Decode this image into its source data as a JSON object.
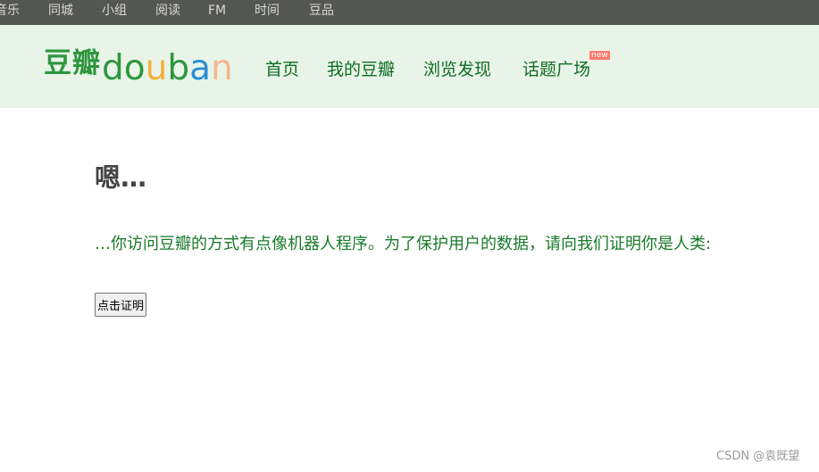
{
  "topbar": {
    "items": [
      "音乐",
      "同城",
      "小组",
      "阅读",
      "FM",
      "时间",
      "豆品"
    ]
  },
  "header": {
    "logo_cn": "豆瓣",
    "logo_en_letters": [
      "d",
      "o",
      "u",
      "b",
      "a",
      "n"
    ],
    "logo_en_colors": [
      "#2e963d",
      "#2e963d",
      "#f2b23c",
      "#2e963d",
      "#2b8fd1",
      "#f5b78c"
    ],
    "nav": [
      "首页",
      "我的豆瓣",
      "浏览发现",
      "话题广场"
    ],
    "new_badge": "new"
  },
  "main": {
    "title": "嗯…",
    "description": "…你访问豆瓣的方式有点像机器人程序。为了保护用户的数据，请向我们证明你是人类:",
    "button_label": "点击证明"
  },
  "watermark": "CSDN @袁既望",
  "colors": {
    "topbar_bg": "#545652",
    "header_bg": "#e9f4e9",
    "brand_green": "#2e963d",
    "nav_green": "#0e6d22",
    "text_green": "#1a7a2b",
    "badge_red": "#ff7a6e"
  }
}
